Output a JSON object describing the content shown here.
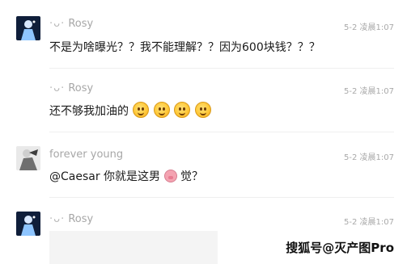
{
  "messages": [
    {
      "user": "Rosy",
      "name_prefix": "·ᴗ·",
      "time": "5-2 凌晨1:07",
      "text": "不是为啥曝光？？我不能理解？？因为600块钱？？？"
    },
    {
      "user": "Rosy",
      "name_prefix": "·ᴗ·",
      "time": "5-2 凌晨1:07",
      "text": "还不够我加油的",
      "emoji_count": 4,
      "emoji_name": "smile-emoji"
    },
    {
      "user": "forever young",
      "time": "5-2 凌晨1:07",
      "text_before": "@Caesar 你就是这男",
      "emoji_name": "pig-emoji",
      "text_after": "觉？"
    },
    {
      "user": "Rosy",
      "name_prefix": "·ᴗ·",
      "time": "5-2 凌晨1:07"
    }
  ],
  "watermark": "搜狐号@灭产图Pro",
  "colors": {
    "text": "#1a1a1a",
    "meta": "#a7a7a7",
    "divider": "#efefef"
  }
}
